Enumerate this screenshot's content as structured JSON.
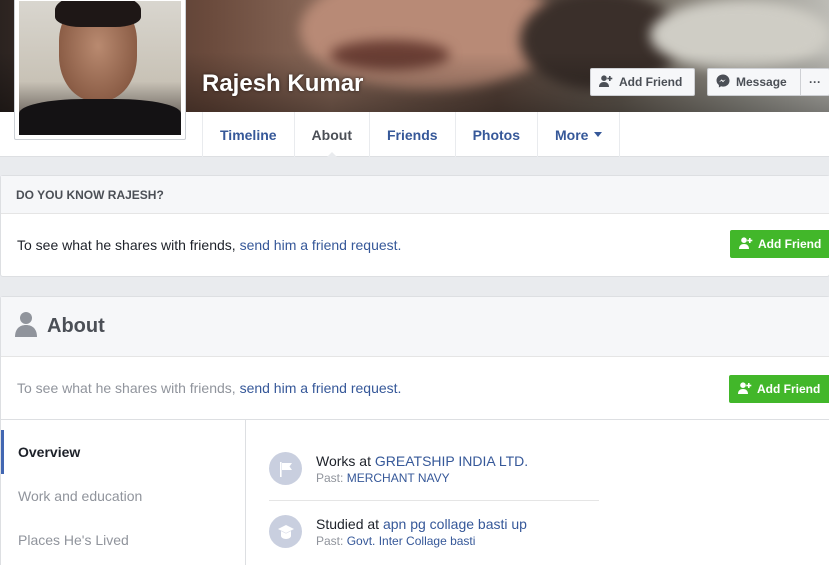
{
  "profile": {
    "name": "Rajesh Kumar"
  },
  "cover_actions": {
    "add_friend": "Add Friend",
    "message": "Message",
    "more": "···"
  },
  "nav": {
    "tabs": [
      {
        "label": "Timeline"
      },
      {
        "label": "About"
      },
      {
        "label": "Friends"
      },
      {
        "label": "Photos"
      },
      {
        "label": "More"
      }
    ]
  },
  "know_panel": {
    "heading": "DO YOU KNOW RAJESH?",
    "text": "To see what he shares with friends,",
    "link": "send him a friend request",
    "period": ".",
    "button": "Add Friend"
  },
  "about_panel": {
    "title": "About",
    "request_text": "To see what he shares with friends,",
    "request_link": "send him a friend request",
    "request_period": ".",
    "button": "Add Friend",
    "sidebar": [
      {
        "label": "Overview"
      },
      {
        "label": "Work and education"
      },
      {
        "label": "Places He's Lived"
      }
    ],
    "entries": [
      {
        "prefix": "Works at",
        "value": "GREATSHIP INDIA LTD.",
        "sub_prefix": "Past:",
        "sub_value": "MERCHANT NAVY",
        "icon": "briefcase-flag-icon"
      },
      {
        "prefix": "Studied at",
        "value": "apn pg collage basti up",
        "sub_prefix": "Past:",
        "sub_value": "Govt. Inter Collage basti",
        "icon": "graduation-cap-icon"
      }
    ]
  },
  "colors": {
    "link": "#365899",
    "green": "#42b72a",
    "background": "#e9ebee"
  }
}
